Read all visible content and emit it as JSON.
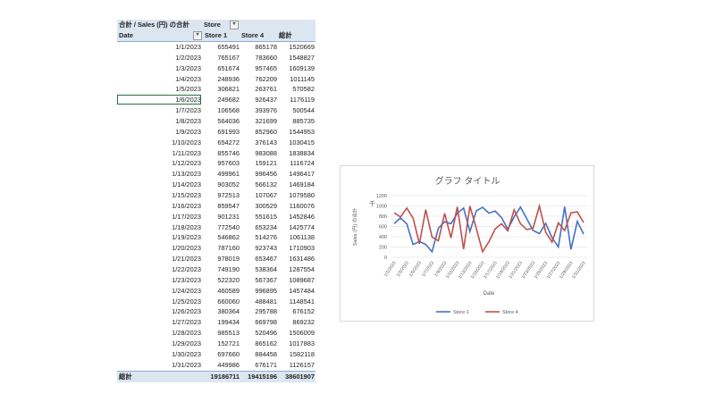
{
  "pivot": {
    "title": "合計 / Sales (円) の合計",
    "column_field": "Store",
    "row_field": "Date",
    "columns": [
      "Store 1",
      "Store 4",
      "総計"
    ],
    "rows": [
      [
        "1/1/2023",
        655491,
        865178,
        1520669
      ],
      [
        "1/2/2023",
        765167,
        783660,
        1548827
      ],
      [
        "1/3/2023",
        651674,
        957465,
        1609139
      ],
      [
        "1/4/2023",
        248936,
        762209,
        1011145
      ],
      [
        "1/5/2023",
        306821,
        263761,
        570582
      ],
      [
        "1/6/2023",
        249682,
        926437,
        1176119
      ],
      [
        "1/7/2023",
        106568,
        393976,
        500544
      ],
      [
        "1/8/2023",
        564036,
        321699,
        885735
      ],
      [
        "1/9/2023",
        691993,
        852960,
        1544953
      ],
      [
        "1/10/2023",
        654272,
        376143,
        1030415
      ],
      [
        "1/11/2023",
        855746,
        983088,
        1838834
      ],
      [
        "1/12/2023",
        957603,
        159121,
        1116724
      ],
      [
        "1/13/2023",
        499961,
        996456,
        1496417
      ],
      [
        "1/14/2023",
        903052,
        566132,
        1469184
      ],
      [
        "1/15/2023",
        972513,
        107067,
        1079580
      ],
      [
        "1/16/2023",
        859547,
        300529,
        1160076
      ],
      [
        "1/17/2023",
        901231,
        551615,
        1452846
      ],
      [
        "1/18/2023",
        772540,
        653234,
        1425774
      ],
      [
        "1/19/2023",
        546862,
        514276,
        1061138
      ],
      [
        "1/20/2023",
        787160,
        923743,
        1710903
      ],
      [
        "1/21/2023",
        978019,
        653467,
        1631486
      ],
      [
        "1/22/2023",
        749190,
        538364,
        1287554
      ],
      [
        "1/23/2023",
        522320,
        567367,
        1089687
      ],
      [
        "1/24/2023",
        460589,
        996895,
        1457484
      ],
      [
        "1/25/2023",
        660060,
        488481,
        1148541
      ],
      [
        "1/26/2023",
        380364,
        295788,
        676152
      ],
      [
        "1/27/2023",
        199434,
        669798,
        869232
      ],
      [
        "1/28/2023",
        985513,
        520496,
        1506009
      ],
      [
        "1/29/2023",
        152721,
        865162,
        1017883
      ],
      [
        "1/30/2023",
        697660,
        884458,
        1582118
      ],
      [
        "1/31/2023",
        449986,
        676171,
        1126157
      ]
    ],
    "total_label": "総計",
    "totals": [
      19186711,
      19415196,
      38601907
    ]
  },
  "chart_data": {
    "type": "line",
    "title": "グラフ タイトル",
    "xlabel": "Date",
    "ylabel": "Sales (円) の合計",
    "unit_label": "千",
    "ylim": [
      0,
      1200
    ],
    "yticks": [
      0,
      200,
      400,
      600,
      800,
      1000,
      1200
    ],
    "x_tick_labels": [
      "1/1/2023",
      "1/3/2023",
      "1/5/2023",
      "1/7/2023",
      "1/9/2023",
      "1/11/2023",
      "1/13/2023",
      "1/15/2023",
      "1/17/2023",
      "1/19/2023",
      "1/21/2023",
      "1/23/2023",
      "1/25/2023",
      "1/27/2023",
      "1/29/2023",
      "1/31/2023"
    ],
    "legend": "bottom",
    "series": [
      {
        "name": "Store 1",
        "color": "#4472c4"
      },
      {
        "name": "Store 4",
        "color": "#c0504d"
      }
    ]
  }
}
